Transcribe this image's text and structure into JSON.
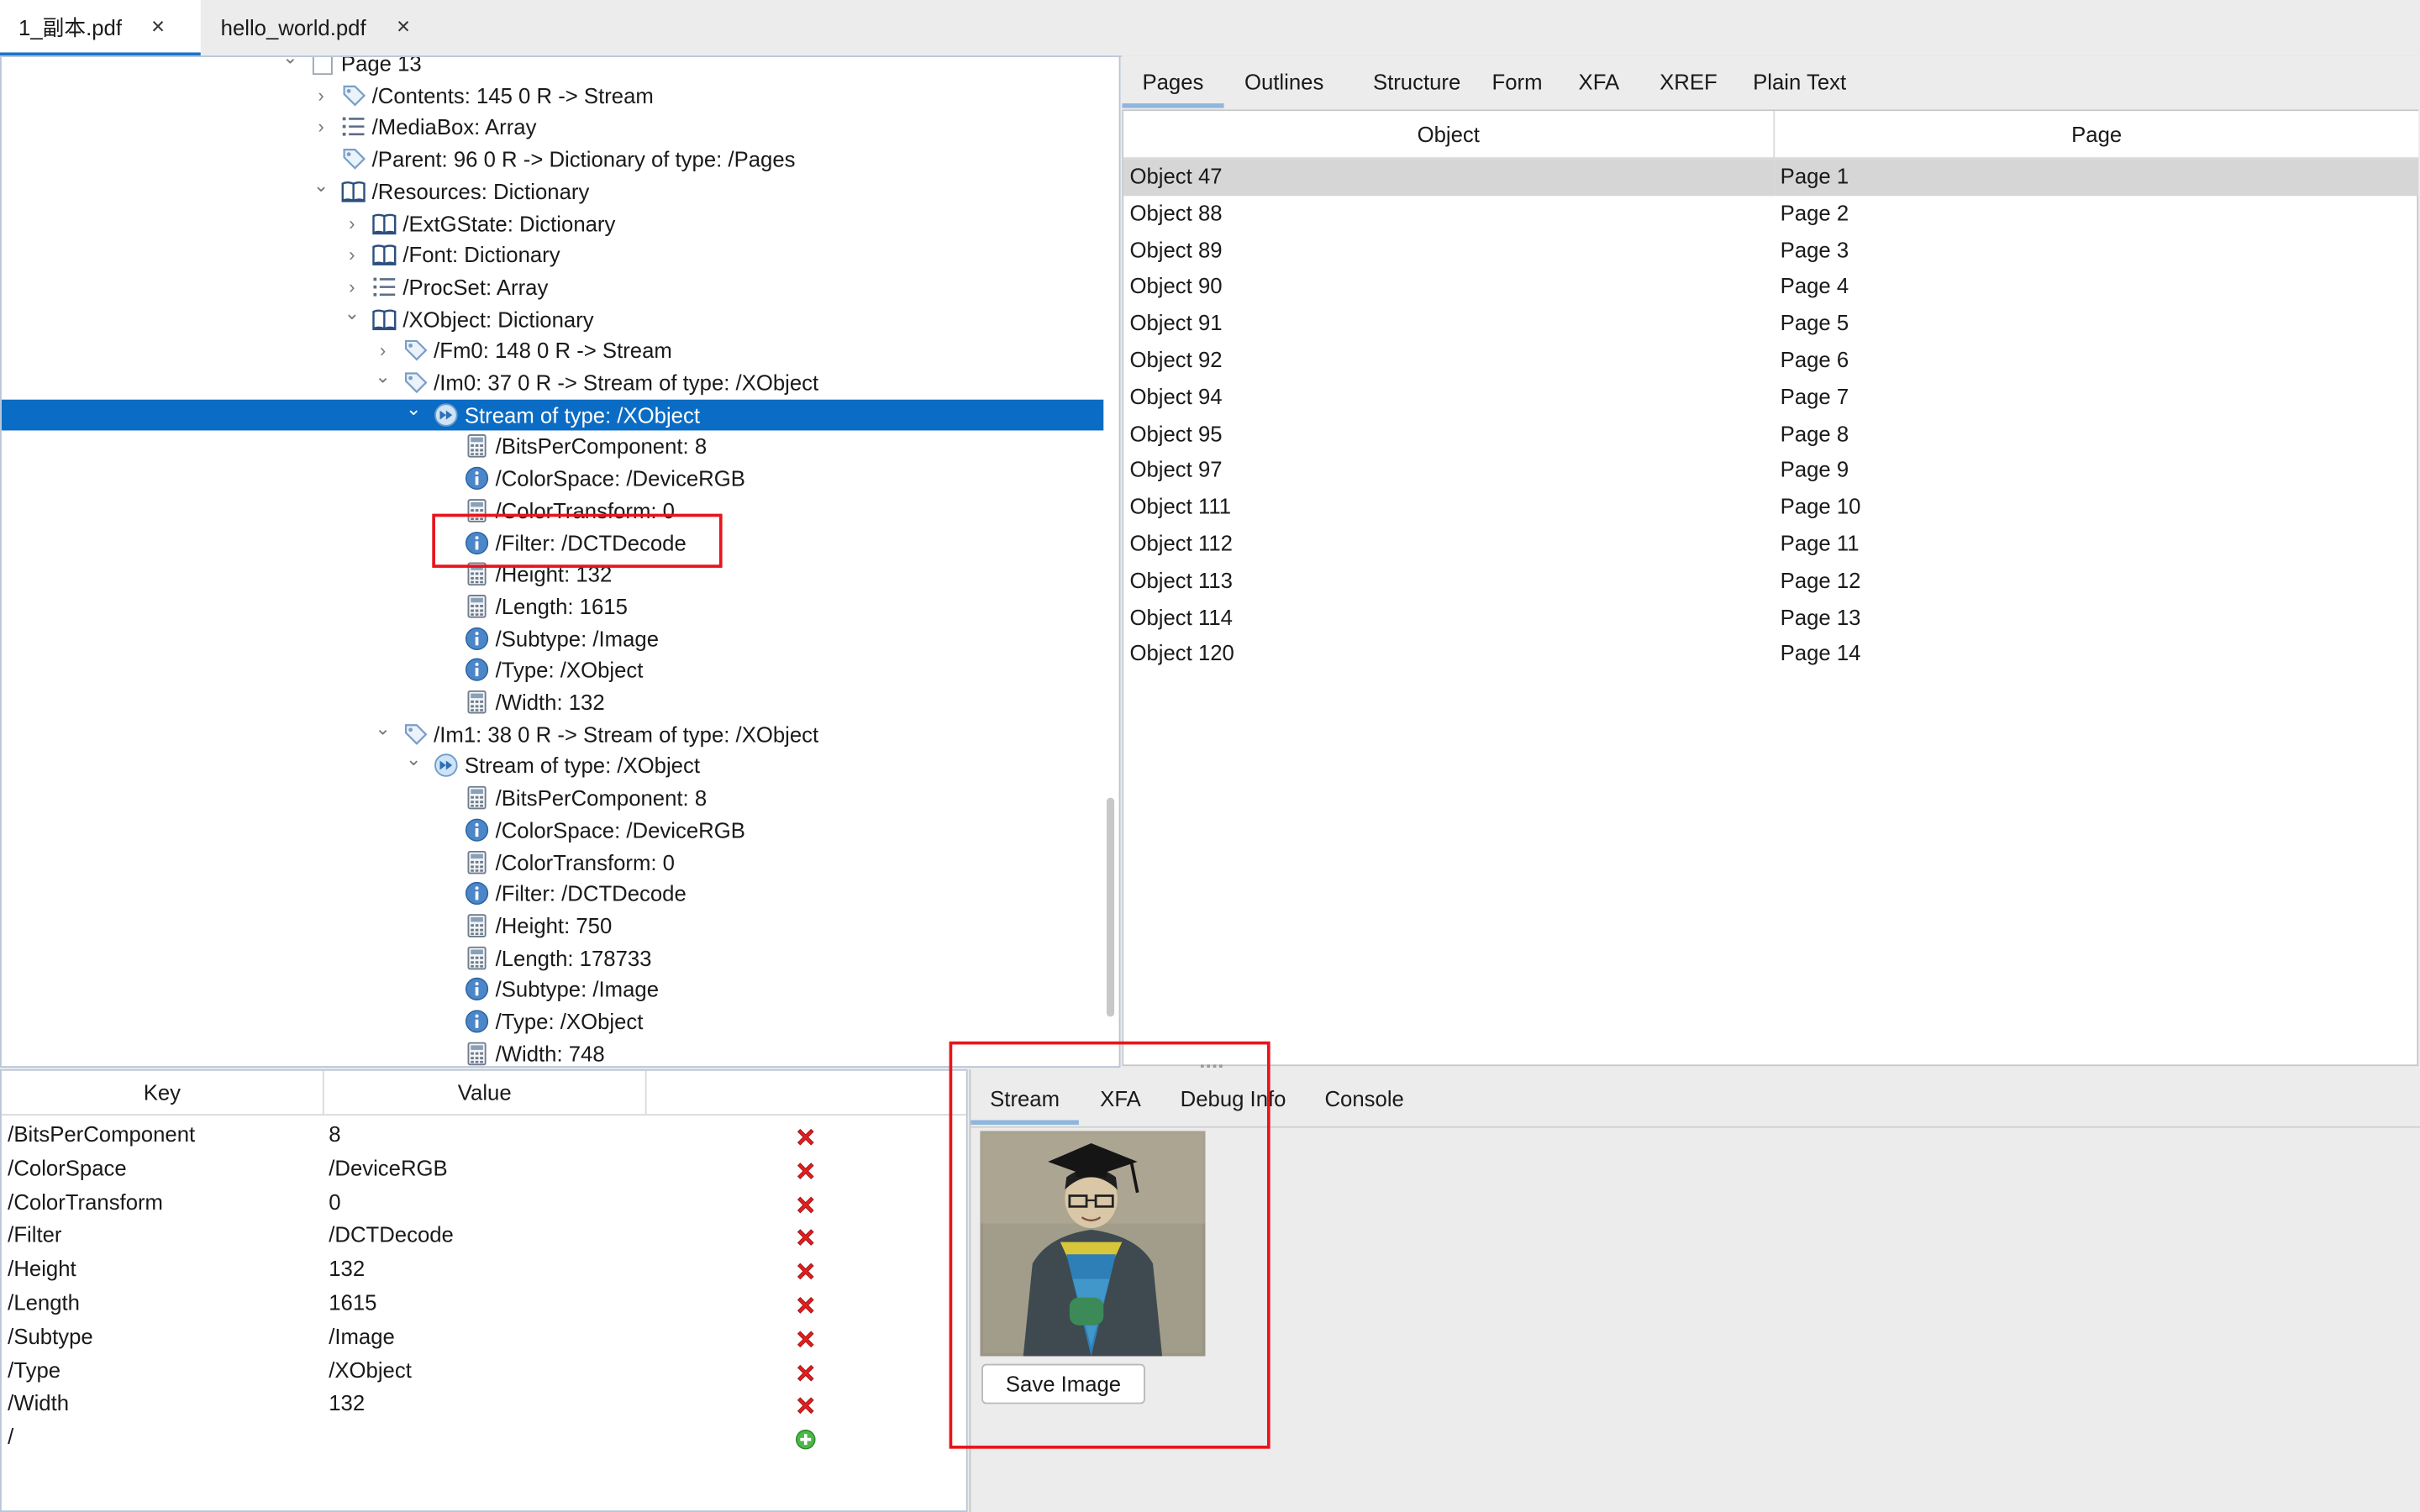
{
  "file_tabs": [
    {
      "label": "1_副本.pdf",
      "close": "×",
      "active": true
    },
    {
      "label": "hello_world.pdf",
      "close": "×",
      "active": false
    }
  ],
  "tree": [
    {
      "label": "Page 13",
      "twisty": "expanded",
      "icon": "page-icon"
    },
    {
      "label": "/Contents: 145 0 R -> Stream",
      "twisty": "collapsed",
      "icon": "tag-icon"
    },
    {
      "label": "/MediaBox: Array",
      "twisty": "collapsed",
      "icon": "list-icon"
    },
    {
      "label": "/Parent: 96 0 R -> Dictionary of type: /Pages",
      "twisty": "none",
      "icon": "tag-icon"
    },
    {
      "label": "/Resources: Dictionary",
      "twisty": "expanded",
      "icon": "book-icon"
    },
    {
      "label": "/ExtGState: Dictionary",
      "twisty": "collapsed",
      "icon": "book-icon"
    },
    {
      "label": "/Font: Dictionary",
      "twisty": "collapsed",
      "icon": "book-icon"
    },
    {
      "label": "/ProcSet: Array",
      "twisty": "collapsed",
      "icon": "list-icon"
    },
    {
      "label": "/XObject: Dictionary",
      "twisty": "expanded",
      "icon": "book-icon"
    },
    {
      "label": "/Fm0: 148 0 R -> Stream",
      "twisty": "collapsed",
      "icon": "tag-icon"
    },
    {
      "label": "/Im0: 37 0 R -> Stream of type: /XObject",
      "twisty": "expanded",
      "icon": "tag-icon"
    },
    {
      "label": "Stream of type: /XObject",
      "twisty": "expanded",
      "icon": "stream-icon",
      "selected": true
    },
    {
      "label": "/BitsPerComponent: 8",
      "twisty": "none",
      "icon": "calc-icon"
    },
    {
      "label": "/ColorSpace: /DeviceRGB",
      "twisty": "none",
      "icon": "info-icon"
    },
    {
      "label": "/ColorTransform: 0",
      "twisty": "none",
      "icon": "calc-icon"
    },
    {
      "label": "/Filter: /DCTDecode",
      "twisty": "none",
      "icon": "info-icon"
    },
    {
      "label": "/Height: 132",
      "twisty": "none",
      "icon": "calc-icon"
    },
    {
      "label": "/Length: 1615",
      "twisty": "none",
      "icon": "calc-icon"
    },
    {
      "label": "/Subtype: /Image",
      "twisty": "none",
      "icon": "info-icon"
    },
    {
      "label": "/Type: /XObject",
      "twisty": "none",
      "icon": "info-icon"
    },
    {
      "label": "/Width: 132",
      "twisty": "none",
      "icon": "calc-icon"
    },
    {
      "label": "/Im1: 38 0 R -> Stream of type: /XObject",
      "twisty": "expanded",
      "icon": "tag-icon"
    },
    {
      "label": "Stream of type: /XObject",
      "twisty": "expanded",
      "icon": "stream-icon"
    },
    {
      "label": "/BitsPerComponent: 8",
      "twisty": "none",
      "icon": "calc-icon"
    },
    {
      "label": "/ColorSpace: /DeviceRGB",
      "twisty": "none",
      "icon": "info-icon"
    },
    {
      "label": "/ColorTransform: 0",
      "twisty": "none",
      "icon": "calc-icon"
    },
    {
      "label": "/Filter: /DCTDecode",
      "twisty": "none",
      "icon": "info-icon"
    },
    {
      "label": "/Height: 750",
      "twisty": "none",
      "icon": "calc-icon"
    },
    {
      "label": "/Length: 178733",
      "twisty": "none",
      "icon": "calc-icon"
    },
    {
      "label": "/Subtype: /Image",
      "twisty": "none",
      "icon": "info-icon"
    },
    {
      "label": "/Type: /XObject",
      "twisty": "none",
      "icon": "info-icon"
    },
    {
      "label": "/Width: 748",
      "twisty": "none",
      "icon": "calc-icon"
    }
  ],
  "right_tabs": [
    "Pages",
    "Outlines",
    "Structure",
    "Form",
    "XFA",
    "XREF",
    "Plain Text"
  ],
  "pages_table": {
    "headers": [
      "Object",
      "Page"
    ],
    "rows": [
      [
        "Object 47",
        "Page 1"
      ],
      [
        "Object 88",
        "Page 2"
      ],
      [
        "Object 89",
        "Page 3"
      ],
      [
        "Object 90",
        "Page 4"
      ],
      [
        "Object 91",
        "Page 5"
      ],
      [
        "Object 92",
        "Page 6"
      ],
      [
        "Object 94",
        "Page 7"
      ],
      [
        "Object 95",
        "Page 8"
      ],
      [
        "Object 97",
        "Page 9"
      ],
      [
        "Object 111",
        "Page 10"
      ],
      [
        "Object 112",
        "Page 11"
      ],
      [
        "Object 113",
        "Page 12"
      ],
      [
        "Object 114",
        "Page 13"
      ],
      [
        "Object 120",
        "Page 14"
      ]
    ]
  },
  "kv_table": {
    "headers": [
      "Key",
      "Value"
    ],
    "rows": [
      {
        "key": "/BitsPerComponent",
        "value": "8",
        "action": "delete-icon"
      },
      {
        "key": "/ColorSpace",
        "value": "/DeviceRGB",
        "action": "delete-icon"
      },
      {
        "key": "/ColorTransform",
        "value": "0",
        "action": "delete-icon"
      },
      {
        "key": "/Filter",
        "value": "/DCTDecode",
        "action": "delete-icon"
      },
      {
        "key": "/Height",
        "value": "132",
        "action": "delete-icon"
      },
      {
        "key": "/Length",
        "value": "1615",
        "action": "delete-icon"
      },
      {
        "key": "/Subtype",
        "value": "/Image",
        "action": "delete-icon"
      },
      {
        "key": "/Type",
        "value": "/XObject",
        "action": "delete-icon"
      },
      {
        "key": "/Width",
        "value": "132",
        "action": "delete-icon"
      },
      {
        "key": "/",
        "value": "",
        "action": "add-icon"
      }
    ]
  },
  "bottom_tabs": [
    "Stream",
    "XFA",
    "Debug Info",
    "Console"
  ],
  "stream_panel": {
    "save_button": "Save Image"
  },
  "colors": {
    "selection": "#0a6cc4",
    "annotation_box": "#e8141b",
    "tab_accent": "#1a73c8"
  }
}
